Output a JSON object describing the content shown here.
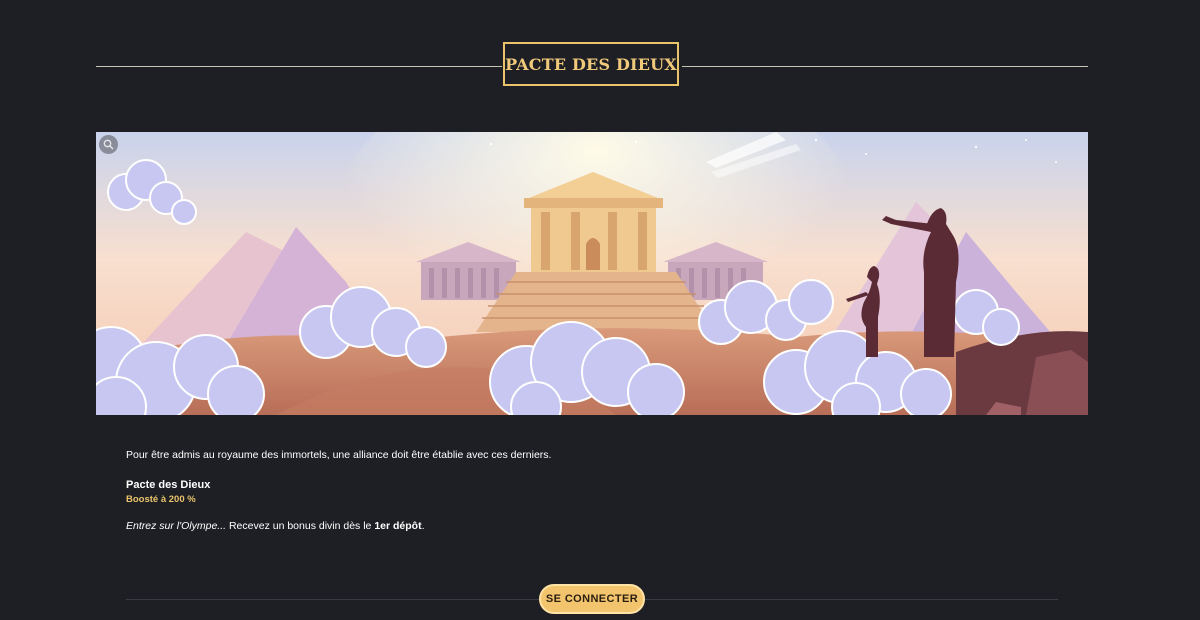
{
  "section": {
    "title": "PACTE DES DIEUX"
  },
  "banner": {
    "image": "olympus-temple-illustration",
    "zoom_icon": "magnifier-icon"
  },
  "content": {
    "intro": "Pour être admis au royaume des immortels, une alliance doit être établie avec ces derniers.",
    "offer_name": "Pacte des Dieux",
    "offer_boost": "Boosté à 200 %",
    "cta_italic": "Entrez sur l'Olympe...",
    "cta_plain": " Recevez un bonus divin dès le ",
    "cta_bold": "1er dépôt",
    "cta_end": "."
  },
  "footer": {
    "login_label": "SE CONNECTER"
  },
  "colors": {
    "background": "#1e1f25",
    "accent_gold": "#e9c46a",
    "button": "#f2c46d"
  }
}
